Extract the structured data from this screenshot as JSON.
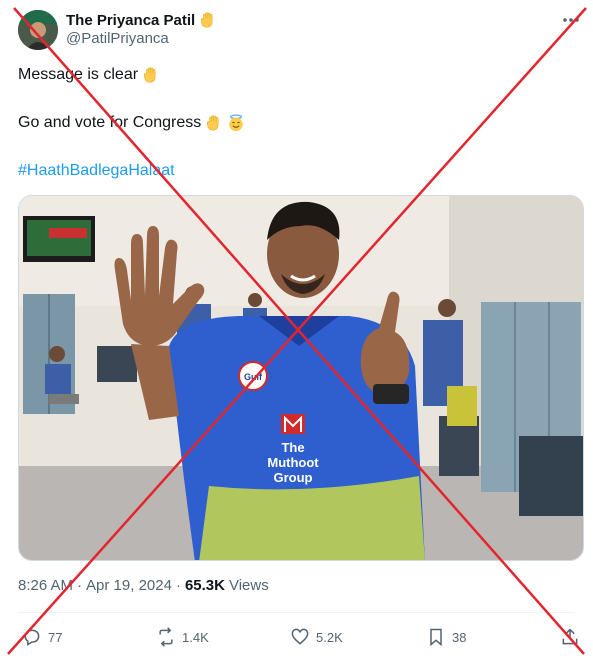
{
  "author": {
    "display_name": "The Priyanca Patil",
    "handle": "@PatilPriyanca"
  },
  "tweet": {
    "line1": "Message is clear",
    "line2": "Go and vote for Congress",
    "hashtag": "#HaathBadlegaHalaat"
  },
  "media": {
    "jersey_line1": "The",
    "jersey_line2": "Muthoot",
    "jersey_line3": "Group",
    "jersey_badge": "Gulf"
  },
  "meta": {
    "time": "8:26 AM",
    "separator": "·",
    "date": "Apr 19, 2024",
    "views_count": "65.3K",
    "views_label": "Views"
  },
  "actions": {
    "replies": "77",
    "reposts": "1.4K",
    "likes": "5.2K",
    "bookmarks": "38"
  },
  "colors": {
    "link": "#1d9bf0",
    "secondary_text": "#536471",
    "overlay_x": "#e3262e"
  },
  "icons": [
    "raised-hand-emoji-icon",
    "smiling-halo-emoji-icon",
    "more-icon",
    "reply-icon",
    "repost-icon",
    "like-icon",
    "bookmark-icon",
    "share-icon"
  ]
}
